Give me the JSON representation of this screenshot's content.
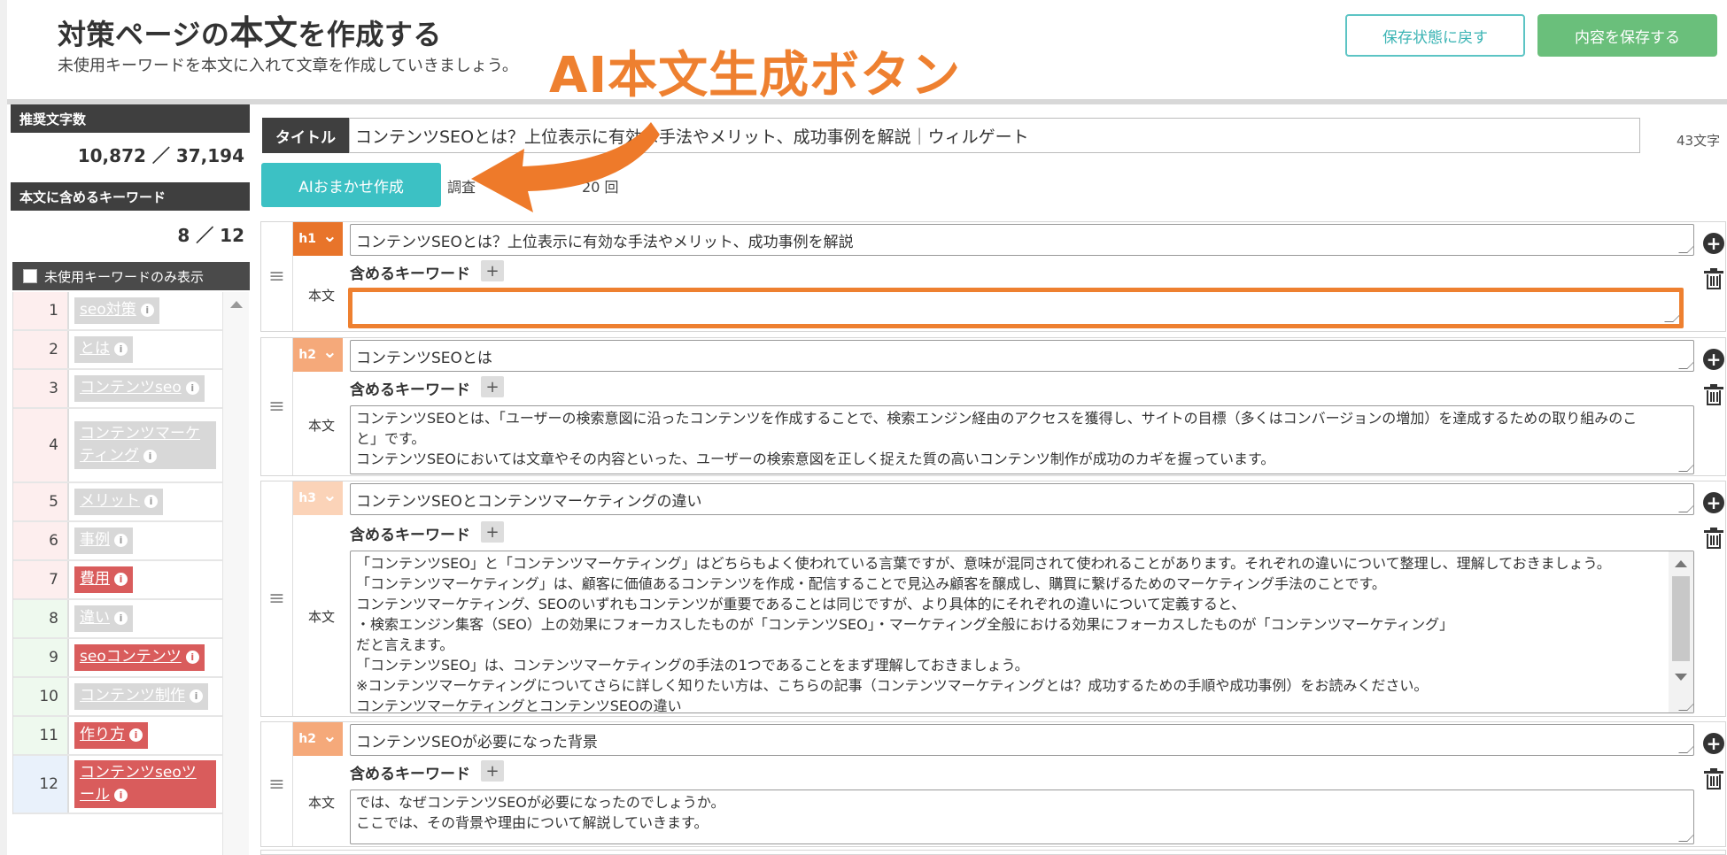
{
  "header": {
    "title_pre": "対策ページの",
    "title_emph": "本文",
    "title_post": "を作成する",
    "subtitle": "未使用キーワードを本文に入れて文章を作成していきましょう。",
    "callout": "AI本文生成ボタン",
    "restore_label": "保存状態に戻す",
    "save_label": "内容を保存する"
  },
  "sidebar": {
    "recommended_label": "推奨文字数",
    "recommended_value": "10,872 ／ 37,194",
    "keywords_label": "本文に含めるキーワード",
    "keywords_value": "8 ／ 12",
    "filter_label": "未使用キーワードのみ表示",
    "keywords": [
      {
        "num": "1",
        "label": "seo対策",
        "used": true
      },
      {
        "num": "2",
        "label": "とは",
        "used": true
      },
      {
        "num": "3",
        "label": "コンテンツseo",
        "used": true
      },
      {
        "num": "4",
        "label": "コンテンツマーケティング",
        "used": true
      },
      {
        "num": "5",
        "label": "メリット",
        "used": true
      },
      {
        "num": "6",
        "label": "事例",
        "used": true
      },
      {
        "num": "7",
        "label": "費用",
        "used": false
      },
      {
        "num": "8",
        "label": "違い",
        "used": true
      },
      {
        "num": "9",
        "label": "seoコンテンツ",
        "used": false
      },
      {
        "num": "10",
        "label": "コンテンツ制作",
        "used": true
      },
      {
        "num": "11",
        "label": "作り方",
        "used": false
      },
      {
        "num": "12",
        "label": "コンテンツseoツール",
        "used": false
      }
    ],
    "row_colors": {
      "used_red": "#fdeeee",
      "green": "#eef9ee",
      "blue": "#e9f1fb"
    }
  },
  "title_row": {
    "label": "タイトル",
    "value": "コンテンツSEOとは？上位表示に有効な手法やメリット、成功事例を解説｜ウィルゲート",
    "char_count": "43文字"
  },
  "ai": {
    "button_label": "AIおまかせ作成",
    "info_prefix": "調査",
    "info_suffix": "20 回"
  },
  "sections": [
    {
      "level": "h1",
      "badge_color": "#e8742a",
      "heading": "コンテンツSEOとは？上位表示に有効な手法やメリット、成功事例を解説",
      "kw_label": "含めるキーワード",
      "body_label": "本文",
      "body": []
    },
    {
      "level": "h2",
      "badge_color": "#f5a97a",
      "heading": "コンテンツSEOとは",
      "kw_label": "含めるキーワード",
      "body_label": "本文",
      "body": [
        "コンテンツSEOとは、「ユーザーの検索意図に沿ったコンテンツを作成することで、検索エンジン経由のアクセスを獲得し、サイトの目標（多くはコンバージョンの増加）を達成するための取り組みのこ",
        "と」です。",
        "コンテンツSEOにおいては文章やその内容といった、ユーザーの検索意図を正しく捉えた質の高いコンテンツ制作が成功のカギを握っています。"
      ]
    },
    {
      "level": "h3",
      "badge_color": "#fbd3b8",
      "heading": "コンテンツSEOとコンテンツマーケティングの違い",
      "kw_label": "含めるキーワード",
      "body_label": "本文",
      "body": [
        "「コンテンツSEO」と「コンテンツマーケティング」はどちらもよく使われている言葉ですが、意味が混同されて使われることがあります。それぞれの違いについて整理し、理解しておきましょう。",
        "「コンテンツマーケティング」は、顧客に価値あるコンテンツを作成・配信することで見込み顧客を醸成し、購買に繋げるためのマーケティング手法のことです。",
        "コンテンツマーケティング、SEOのいずれもコンテンツが重要であることは同じですが、より具体的にそれぞれの違いについて定義すると、",
        "・検索エンジン集客（SEO）上の効果にフォーカスしたものが「コンテンツSEO」・マーケティング全般における効果にフォーカスしたものが「コンテンツマーケティング」",
        "だと言えます。",
        "「コンテンツSEO」は、コンテンツマーケティングの手法の1つであることをまず理解しておきましょう。",
        "※コンテンツマーケティングについてさらに詳しく知りたい方は、こちらの記事（コンテンツマーケティングとは？成功するための手順や成功事例）をお読みください。",
        "コンテンツマーケティングとコンテンツSEOの違い"
      ]
    },
    {
      "level": "h2",
      "badge_color": "#f5a97a",
      "heading": "コンテンツSEOが必要になった背景",
      "kw_label": "含めるキーワード",
      "body_label": "本文",
      "body": [
        "では、なぜコンテンツSEOが必要になったのでしょうか。",
        "ここでは、その背景や理由について解説していきます。"
      ]
    }
  ],
  "accent": {
    "teal": "#3cc1c4",
    "green": "#6abf7b",
    "orange": "#ee8030",
    "dark": "#3f3f3f"
  }
}
